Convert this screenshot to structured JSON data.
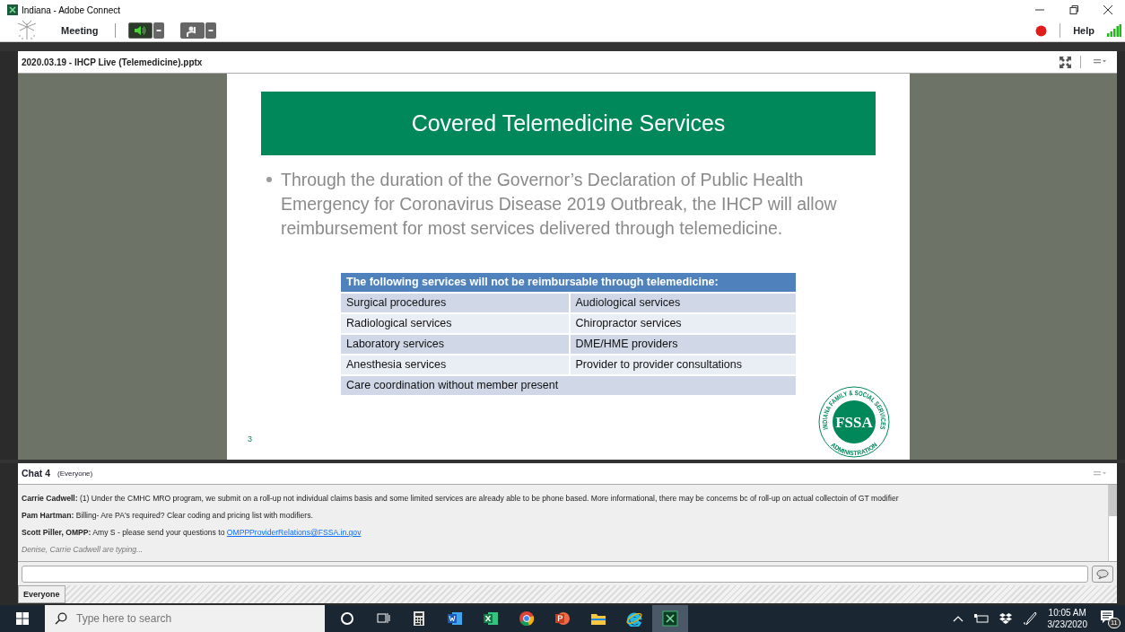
{
  "window": {
    "title": "Indiana - Adobe Connect"
  },
  "menu_bar": {
    "menu": "Meeting",
    "speaker_on": true,
    "help": "Help"
  },
  "share_pod": {
    "title": "2020.03.19 - IHCP Live (Telemedicine).pptx",
    "slide": {
      "title": "Covered Telemedicine Services",
      "bullet": "Through the duration of the Governor’s Declaration of Public Health Emergency for Coronavirus Disease 2019 Outbreak, the IHCP will allow reimbursement for most services delivered through telemedicine.",
      "table": {
        "header": "The following services will not be reimbursable through telemedicine:",
        "rows": [
          [
            "Surgical procedures",
            "Audiological services"
          ],
          [
            "Radiological services",
            "Chiropractor services"
          ],
          [
            "Laboratory services",
            "DME/HME providers"
          ],
          [
            "Anesthesia services",
            "Provider to provider consultations"
          ],
          [
            {
              "text": "Care coordination without member present",
              "colspan": 2
            }
          ]
        ]
      },
      "page_number": "3",
      "logo": {
        "initials": "FSSA",
        "ring_top": "INDIANA FAMILY & SOCIAL SERVICES",
        "ring_bottom": "ADMINISTRATION"
      }
    }
  },
  "chat_pod": {
    "title": "Chat 4",
    "audience": "(Everyone)",
    "messages": [
      {
        "sender": "Carrie Cadwell:",
        "text": "(1) Under the CMHC MRO program, we submit on a roll-up not individual claims basis and some limited services are already able to be phone based. More informational, there may be concerns bc of roll-up on actual collectoin of GT modifier"
      },
      {
        "sender": "Pam Hartman:",
        "text": "Billing- Are PA's required? Clear coding and pricing list with modifiers."
      },
      {
        "sender": "Scott Piller, OMPP:",
        "text": "Amy S - please send your questions to",
        "link": "OMPPProviderRelations@FSSA.in.gov"
      }
    ],
    "typing": "Denise, Carrie Cadwell are typing...",
    "tabs": [
      {
        "label": "Everyone",
        "selected": true
      }
    ]
  },
  "taskbar": {
    "search_placeholder": "Type here to search",
    "apps": [
      {
        "kind": "cortana",
        "selected": false
      },
      {
        "kind": "taskview",
        "selected": false
      },
      {
        "kind": "calculator",
        "selected": false
      },
      {
        "kind": "word",
        "selected": false
      },
      {
        "kind": "excel",
        "selected": false
      },
      {
        "kind": "chrome",
        "selected": false
      },
      {
        "kind": "powerpoint",
        "selected": false
      },
      {
        "kind": "explorer",
        "selected": false
      },
      {
        "kind": "ie",
        "selected": false
      },
      {
        "kind": "connect",
        "selected": true
      }
    ],
    "time": "10:05 AM",
    "date": "3/23/2020",
    "notifications": "11"
  }
}
